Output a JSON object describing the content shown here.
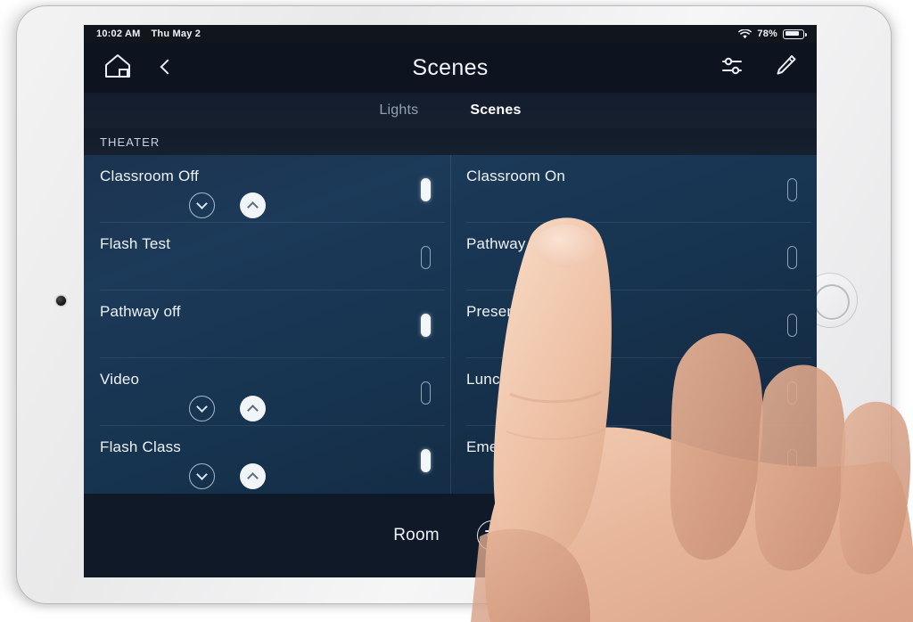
{
  "status_bar": {
    "time": "10:02 AM",
    "date": "Thu May 2",
    "wifi_icon": "wifi-icon",
    "battery_percent": "78%",
    "battery_icon": "battery-icon"
  },
  "nav_bar": {
    "home_icon": "home-icon",
    "back_icon": "back-chevron-icon",
    "title": "Scenes",
    "settings_icon": "sliders-icon",
    "edit_icon": "pencil-icon"
  },
  "tabs": [
    {
      "label": "Lights",
      "active": false
    },
    {
      "label": "Scenes",
      "active": true
    }
  ],
  "section": {
    "title": "THEATER"
  },
  "scenes": [
    {
      "name": "Classroom Off",
      "state": "on",
      "has_controls": true,
      "down_icon": "chevron-down-icon",
      "up_icon": "chevron-up-icon"
    },
    {
      "name": "Classroom On",
      "state": "off",
      "has_controls": false
    },
    {
      "name": "Flash Test",
      "state": "off",
      "has_controls": false
    },
    {
      "name": "Pathway on",
      "state": "off",
      "has_controls": false
    },
    {
      "name": "Pathway off",
      "state": "on",
      "has_controls": false
    },
    {
      "name": "Presentation",
      "state": "off",
      "has_controls": false
    },
    {
      "name": "Video",
      "state": "off",
      "has_controls": true,
      "down_icon": "chevron-down-icon",
      "up_icon": "chevron-up-icon"
    },
    {
      "name": "Lunch Flash",
      "state": "off",
      "has_controls": false
    },
    {
      "name": "Flash Class",
      "state": "on",
      "has_controls": true,
      "down_icon": "chevron-down-icon",
      "up_icon": "chevron-up-icon"
    },
    {
      "name": "Emergency",
      "state": "off",
      "has_controls": false
    }
  ],
  "bottom_bar": {
    "room_label": "Room",
    "filter_icon": "filter-sort-icon"
  },
  "colors": {
    "screen_dark": "#0e141f",
    "list_blue": "#1c3a59",
    "accent_white": "#f4f7fa",
    "bezel": "#f0f0f1"
  }
}
